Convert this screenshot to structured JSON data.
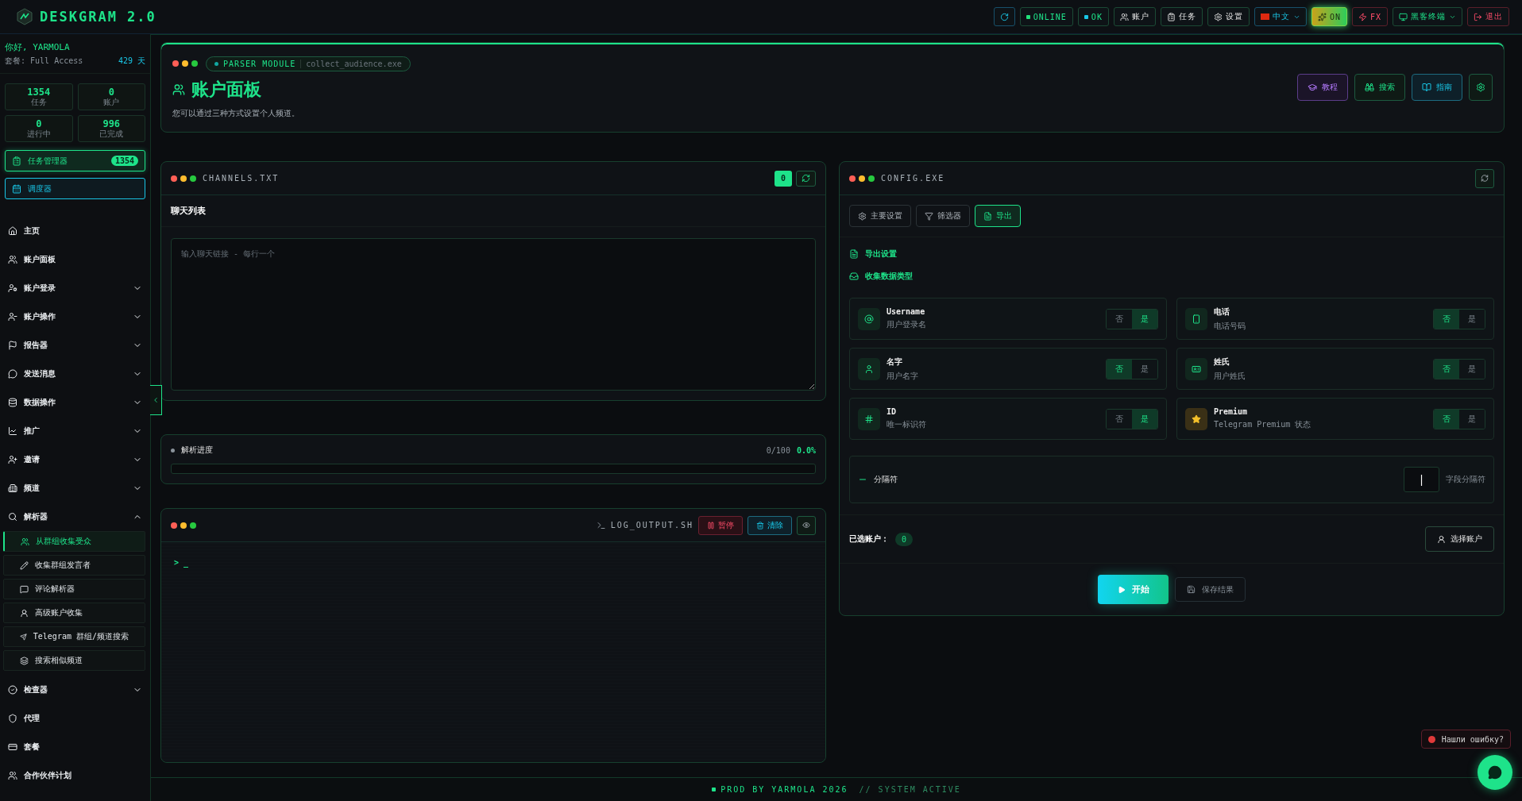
{
  "brand": {
    "name": "DESKGRAM 2.0"
  },
  "topbar": [
    {
      "kind": "refresh"
    },
    {
      "kind": "status",
      "label": "ONLINE",
      "color": "#22e07a"
    },
    {
      "kind": "status",
      "label": "OK",
      "color": "#19c6e6"
    },
    {
      "kind": "nav",
      "label": "账户"
    },
    {
      "kind": "nav",
      "label": "任务"
    },
    {
      "kind": "nav",
      "label": "设置"
    },
    {
      "kind": "language",
      "label": "中文"
    },
    {
      "kind": "effects",
      "label": "ON",
      "on": true
    },
    {
      "kind": "fx",
      "label": "FX"
    },
    {
      "kind": "terminal",
      "label": "黑客终端"
    },
    {
      "kind": "logout",
      "label": "退出"
    }
  ],
  "user": {
    "greeting": "你好, YARMOLA",
    "plan": "套餐: Full Access",
    "days": "429 天"
  },
  "stats": [
    {
      "value": "1354",
      "label": "任务"
    },
    {
      "value": "0",
      "label": "账户"
    },
    {
      "value": "0",
      "label": "进行中"
    },
    {
      "value": "996",
      "label": "已完成"
    }
  ],
  "quick": [
    {
      "kind": "tasks",
      "label": "任务管理器",
      "badge": "1354"
    },
    {
      "kind": "scheduler",
      "label": "调度器"
    }
  ],
  "nav": [
    {
      "label": "主页"
    },
    {
      "label": "账户面板"
    },
    {
      "label": "账户登录",
      "expanded": false
    },
    {
      "label": "账户操作",
      "expanded": false
    },
    {
      "label": "报告器",
      "expanded": false
    },
    {
      "label": "发送消息",
      "expanded": false
    },
    {
      "label": "数据操作",
      "expanded": false
    },
    {
      "label": "推广",
      "expanded": false
    },
    {
      "label": "邀请",
      "expanded": false
    },
    {
      "label": "频道",
      "expanded": false
    },
    {
      "label": "解析器",
      "expanded": true,
      "children": [
        {
          "label": "从群组收集受众",
          "selected": true
        },
        {
          "label": "收集群组发言者",
          "selected": false
        },
        {
          "label": "评论解析器",
          "selected": false
        },
        {
          "label": "高级账户收集",
          "selected": false
        },
        {
          "label": "Telegram 群组/频道搜索",
          "selected": false
        },
        {
          "label": "搜索相似频道",
          "selected": false
        }
      ]
    },
    {
      "label": "检查器",
      "expanded": false
    },
    {
      "label": "代理"
    },
    {
      "label": "套餐"
    },
    {
      "label": "合作伙伴计划"
    }
  ],
  "header": {
    "module": "PARSER MODULE",
    "file": "collect_audience.exe",
    "title": "账户面板",
    "subtitle": "您可以通过三种方式设置个人频道。",
    "buttons": [
      {
        "kind": "tutorial",
        "label": "教程"
      },
      {
        "kind": "search",
        "label": "搜索"
      },
      {
        "kind": "guide",
        "label": "指南"
      },
      {
        "kind": "settings"
      }
    ]
  },
  "channels": {
    "file": "CHANNELS.TXT",
    "count": "0",
    "heading": "聊天列表",
    "placeholder": "输入聊天链接 - 每行一个"
  },
  "progress": {
    "label": "解析进度",
    "count": "0/100",
    "percent": "0.0%",
    "level": 0
  },
  "log": {
    "file": "LOG_OUTPUT.SH",
    "pause": "暂停",
    "clear": "清除",
    "prompt": ">",
    "cursor": "_"
  },
  "config": {
    "file": "CONFIG.EXE",
    "tabs": [
      {
        "label": "主要设置",
        "selected": false
      },
      {
        "label": "筛选器",
        "selected": false
      },
      {
        "label": "导出",
        "selected": true
      }
    ],
    "section": "导出设置",
    "subsection": "收集数据类型",
    "fields": [
      {
        "name": "Username",
        "hint": "用户登录名",
        "options": [
          {
            "label": "否",
            "selected": false
          },
          {
            "label": "是",
            "selected": true
          }
        ]
      },
      {
        "name": "电话",
        "hint": "电话号码",
        "options": [
          {
            "label": "否",
            "selected": true
          },
          {
            "label": "是",
            "selected": false
          }
        ]
      },
      {
        "name": "名字",
        "hint": "用户名字",
        "options": [
          {
            "label": "否",
            "selected": true
          },
          {
            "label": "是",
            "selected": false
          }
        ]
      },
      {
        "name": "姓氏",
        "hint": "用户姓氏",
        "options": [
          {
            "label": "否",
            "selected": true
          },
          {
            "label": "是",
            "selected": false
          }
        ]
      },
      {
        "name": "ID",
        "hint": "唯一标识符",
        "options": [
          {
            "label": "否",
            "selected": false
          },
          {
            "label": "是",
            "selected": true
          }
        ]
      },
      {
        "name": "Premium",
        "hint": "Telegram Premium 状态",
        "options": [
          {
            "label": "否",
            "selected": true
          },
          {
            "label": "是",
            "selected": false
          }
        ]
      }
    ],
    "separator": {
      "label": "分隔符",
      "value": "|",
      "hint": "字段分隔符"
    },
    "selected_label": "已选账户：",
    "selected_count": "0",
    "choose": "选择账户",
    "start": "开始",
    "save": "保存结果"
  },
  "toast": "Нашли ошибку?",
  "footer": {
    "credit": "PROD BY YARMOLA 2026",
    "status": "// SYSTEM ACTIVE"
  }
}
